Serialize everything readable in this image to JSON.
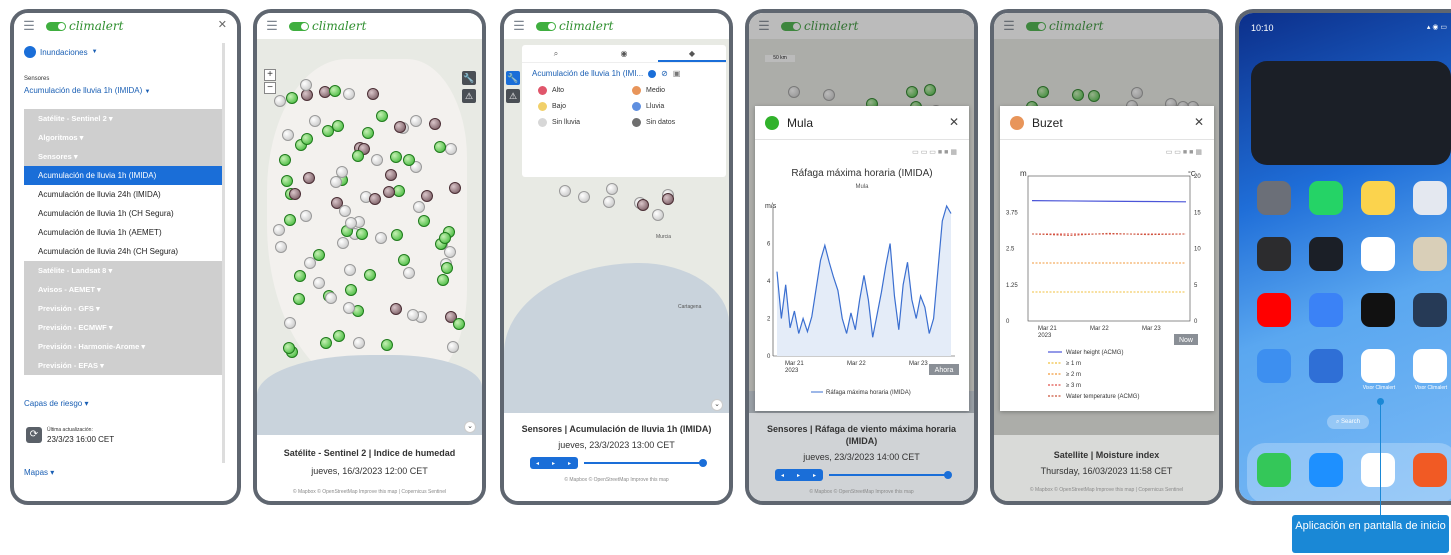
{
  "brand": "climalert",
  "screen1": {
    "selector": "Inundaciones",
    "sensors_caption": "Sensores",
    "sensors_value": "Acumulación de lluvia 1h (IMIDA)",
    "groups_top": [
      "Satélite - Sentinel 2",
      "Algoritmos",
      "Sensores"
    ],
    "sensor_items": [
      "Acumulación de lluvia 1h (IMIDA)",
      "Acumulación de lluvia 24h (IMIDA)",
      "Acumulación de lluvia 1h (CH Segura)",
      "Acumulación de lluvia 1h (AEMET)",
      "Acumulación de lluvia 24h (CH Segura)"
    ],
    "selected_index": 0,
    "groups_bottom": [
      "Satélite - Landsat 8",
      "Avisos - AEMET",
      "Previsión - GFS",
      "Previsión - ECMWF",
      "Previsión - Harmonie-Arome",
      "Previsión - EFAS"
    ],
    "risk_layers": "Capas de riesgo",
    "last_update_caption": "Última actualización:",
    "last_update_value": "23/3/23 16:00 CET",
    "maps": "Mapas"
  },
  "screen2": {
    "footer_title": "Satélite - Sentinel 2 | Indice de humedad",
    "footer_date": "jueves, 16/3/2023 12:00 CET",
    "credits": "© Mapbox © OpenStreetMap Improve this map | Copernicus Sentinel"
  },
  "screen3": {
    "legend_title": "Acumulación de lluvia 1h (IMI...",
    "legend_items": [
      {
        "label": "Alto",
        "color": "#e0566b"
      },
      {
        "label": "Medio",
        "color": "#e8955a"
      },
      {
        "label": "Bajo",
        "color": "#f1d06a"
      },
      {
        "label": "Lluvia",
        "color": "#5f8fe0"
      },
      {
        "label": "Sin lluvia",
        "color": "#d7d7d7"
      },
      {
        "label": "Sin datos",
        "color": "#6f6f6f"
      }
    ],
    "footer_title": "Sensores | Acumulación de lluvia 1h (IMIDA)",
    "footer_date": "jueves, 23/3/2023 13:00 CET",
    "credits": "© Mapbox © OpenStreetMap Improve this map",
    "map_labels": [
      "Murcia",
      "Cartagena"
    ]
  },
  "screen4": {
    "station": "Mula",
    "chart_data": {
      "type": "line",
      "title": "Ráfaga máxima horaria (IMIDA)",
      "subtitle": "Mula",
      "ylabel": "m/s",
      "ylim": [
        0,
        8
      ],
      "yticks": [
        "0",
        "2",
        "4",
        "6"
      ],
      "xticks": [
        "Mar 21\n2023",
        "Mar 22",
        "Mar 23"
      ],
      "series": [
        {
          "name": "Ráfaga máxima horaria (IMIDA)",
          "values": [
            4.5,
            2.0,
            3.8,
            1.5,
            2.4,
            1.2,
            2.0,
            1.3,
            2.1,
            3.6,
            5.1,
            5.9,
            5.0,
            4.2,
            3.5,
            2.0,
            1.2,
            2.3,
            1.4,
            3.0,
            4.3,
            3.0,
            1.0,
            2.2,
            3.4,
            4.8,
            6.0,
            3.2,
            1.4,
            3.8,
            5.0,
            3.0,
            2.0,
            3.2,
            2.6,
            1.2,
            2.0,
            4.6,
            7.2,
            8.0,
            7.6
          ]
        }
      ],
      "now_label": "Ahora"
    },
    "footer_title": "Sensores | Ráfaga de viento máxima horaria (IMIDA)",
    "footer_date": "jueves, 23/3/2023 14:00 CET",
    "credits": "© Mapbox © OpenStreetMap Improve this map"
  },
  "screen5": {
    "station": "Buzet",
    "chart_data": {
      "type": "line",
      "left_unit": "m",
      "right_unit": "°C",
      "ylim_left": [
        0,
        5
      ],
      "ylim_right": [
        0,
        20
      ],
      "yticks_left": [
        "3.75",
        "2.5",
        "1.25",
        "0"
      ],
      "yticks_right": [
        "20",
        "15",
        "10",
        "5",
        "0"
      ],
      "xticks": [
        "Mar 21\n2023",
        "Mar 22",
        "Mar 23"
      ],
      "series": [
        {
          "name": "Water height (ACMG)",
          "values": [
            4.15,
            4.14,
            4.13,
            4.12,
            4.11
          ]
        },
        {
          "name": "≥ 1 m",
          "values": [
            1.0,
            1.0
          ]
        },
        {
          "name": "≥ 2 m",
          "values": [
            2.0,
            2.0
          ]
        },
        {
          "name": "≥ 3 m",
          "values": [
            3.0,
            3.0
          ]
        },
        {
          "name": "Water temperature (ACMG)",
          "values": [
            12.0,
            11.8,
            12.1,
            11.9,
            12.0
          ]
        }
      ],
      "now_label": "Now"
    },
    "footer_title": "Satellite | Moisture index",
    "footer_date": "Thursday, 16/03/2023 11:58 CET",
    "credits": "© Mapbox © OpenStreetMap Improve this map | Copernicus Sentinel"
  },
  "screen6": {
    "time": "10:10",
    "apps": [
      "Visor Climalert",
      "Visor Climalert"
    ],
    "search": "Search"
  },
  "callout": "Aplicación en pantalla de inicio",
  "scale_label": "50 km"
}
